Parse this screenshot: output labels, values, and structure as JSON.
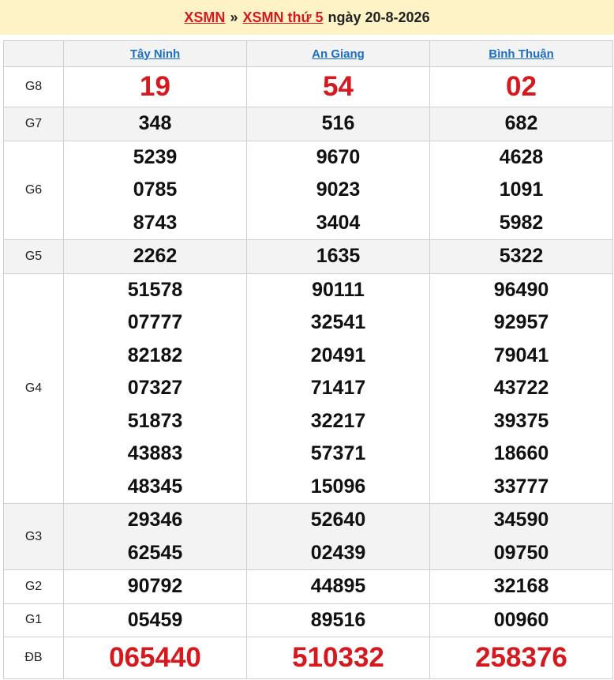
{
  "header": {
    "link1": "XSMN",
    "separator": "»",
    "link2": "XSMN thứ 5",
    "date": "ngày 20-8-2026"
  },
  "provinces": [
    "Tây Ninh",
    "An Giang",
    "Bình Thuận"
  ],
  "prizes": [
    {
      "label": "G8",
      "values": [
        [
          "19"
        ],
        [
          "54"
        ],
        [
          "02"
        ]
      ]
    },
    {
      "label": "G7",
      "values": [
        [
          "348"
        ],
        [
          "516"
        ],
        [
          "682"
        ]
      ]
    },
    {
      "label": "G6",
      "values": [
        [
          "5239",
          "0785",
          "8743"
        ],
        [
          "9670",
          "9023",
          "3404"
        ],
        [
          "4628",
          "1091",
          "5982"
        ]
      ]
    },
    {
      "label": "G5",
      "values": [
        [
          "2262"
        ],
        [
          "1635"
        ],
        [
          "5322"
        ]
      ]
    },
    {
      "label": "G4",
      "values": [
        [
          "51578",
          "07777",
          "82182",
          "07327",
          "51873",
          "43883",
          "48345"
        ],
        [
          "90111",
          "32541",
          "20491",
          "71417",
          "32217",
          "57371",
          "15096"
        ],
        [
          "96490",
          "92957",
          "79041",
          "43722",
          "39375",
          "18660",
          "33777"
        ]
      ]
    },
    {
      "label": "G3",
      "values": [
        [
          "29346",
          "62545"
        ],
        [
          "52640",
          "02439"
        ],
        [
          "34590",
          "09750"
        ]
      ]
    },
    {
      "label": "G2",
      "values": [
        [
          "90792"
        ],
        [
          "44895"
        ],
        [
          "32168"
        ]
      ]
    },
    {
      "label": "G1",
      "values": [
        [
          "05459"
        ],
        [
          "89516"
        ],
        [
          "00960"
        ]
      ]
    },
    {
      "label": "ĐB",
      "values": [
        [
          "065440"
        ],
        [
          "510332"
        ],
        [
          "258376"
        ]
      ]
    }
  ],
  "colors": {
    "accent_red": "#d6181f",
    "link_blue": "#1a6fc9",
    "header_bg": "#fdf3c6",
    "alt_row_bg": "#f3f3f3"
  }
}
